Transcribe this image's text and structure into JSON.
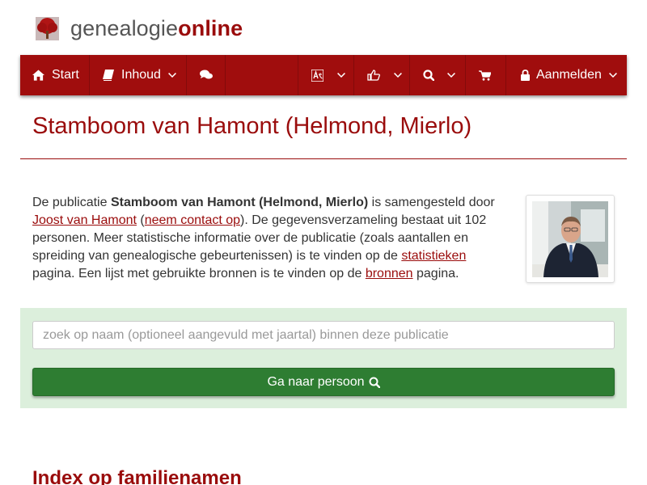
{
  "brand": {
    "name_part1": "genealogie",
    "name_part2": "online"
  },
  "nav": {
    "start_label": "Start",
    "contents_label": "Inhoud",
    "login_label": "Aanmelden",
    "icons": {
      "start": "home-icon",
      "contents": "book-icon",
      "chat": "comments-icon",
      "language": "translate-icon",
      "share": "thumbs-up-icon",
      "search": "search-icon",
      "cart": "cart-icon",
      "login": "lock-icon",
      "dropdown": "chevron-down-icon"
    }
  },
  "page": {
    "title": "Stamboom van Hamont (Helmond, Mierlo)"
  },
  "intro": {
    "text1": "De publicatie ",
    "publication_name": "Stamboom van Hamont (Helmond, Mierlo)",
    "text2": " is samengesteld door ",
    "author_link": "Joost van Hamont",
    "text3": " (",
    "contact_link": "neem contact op",
    "text4": "). De gegevensverzameling bestaat uit 102 personen. Meer statistische informatie over de publicatie (zoals aantallen en spreiding van genealogische gebeurtenissen) is te vinden op de ",
    "stats_link": "statistieken",
    "text5": " pagina. Een lijst met gebruikte bronnen is te vinden op de ",
    "sources_link": "bronnen",
    "text6": " pagina."
  },
  "search": {
    "placeholder": "zoek op naam (optioneel aangevuld met jaartal) binnen deze publicatie",
    "value": "",
    "button_label": "Ga naar persoon"
  },
  "index": {
    "heading": "Index op familienamen"
  },
  "colors": {
    "brand_red": "#9a0c0c",
    "nav_red": "#a00d0d",
    "panel_green": "#dcefdc",
    "button_green": "#2e7d32"
  }
}
